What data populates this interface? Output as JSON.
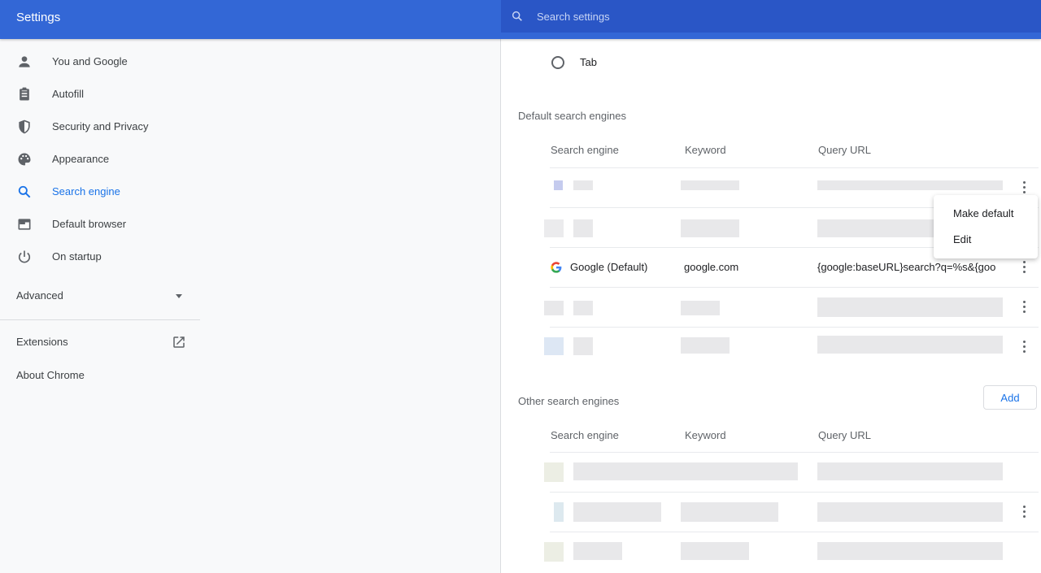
{
  "app": {
    "title": "Settings"
  },
  "search": {
    "placeholder": "Search settings"
  },
  "sidebar": {
    "items": [
      {
        "label": "You and Google",
        "icon": "person-icon"
      },
      {
        "label": "Autofill",
        "icon": "clipboard-icon"
      },
      {
        "label": "Security and Privacy",
        "icon": "shield-icon"
      },
      {
        "label": "Appearance",
        "icon": "palette-icon"
      },
      {
        "label": "Search engine",
        "icon": "search-icon",
        "active": true
      },
      {
        "label": "Default browser",
        "icon": "browser-window-icon"
      },
      {
        "label": "On startup",
        "icon": "power-icon"
      }
    ],
    "advanced": "Advanced",
    "extensions": "Extensions",
    "about": "About Chrome"
  },
  "main": {
    "radio_label": "Tab",
    "default_section": {
      "title": "Default search engines",
      "columns": [
        "Search engine",
        "Keyword",
        "Query URL"
      ],
      "google_row": {
        "name": "Google (Default)",
        "keyword": "google.com",
        "url": "{google:baseURL}search?q=%s&{google:RLZ}"
      }
    },
    "other_section": {
      "title": "Other search engines",
      "add_label": "Add",
      "columns": [
        "Search engine",
        "Keyword",
        "Query URL"
      ]
    },
    "context_menu": {
      "make_default": "Make default",
      "edit": "Edit"
    }
  },
  "colors": {
    "header_blue": "#3367d6",
    "search_bar_blue": "#2a56c6",
    "accent": "#1a73e8"
  }
}
